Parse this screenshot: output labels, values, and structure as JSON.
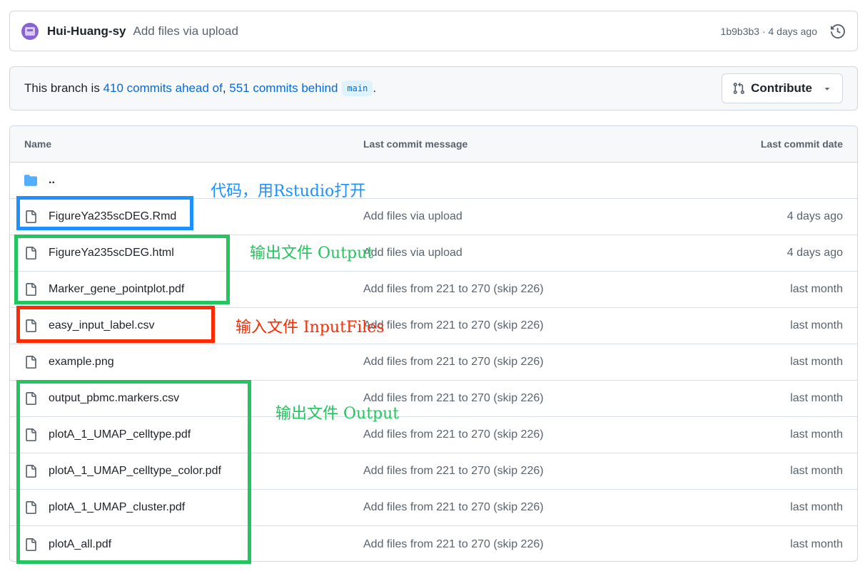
{
  "commit": {
    "author": "Hui-Huang-sy",
    "message": "Add files via upload",
    "meta": "1b9b3b3 · 4 days ago"
  },
  "branch": {
    "prefix": "This branch is ",
    "ahead": "410 commits ahead of",
    "sep": ", ",
    "behind": "551 commits behind",
    "ref": "main",
    "suffix": ".",
    "contribute_label": "Contribute"
  },
  "table": {
    "headers": {
      "name": "Name",
      "message": "Last commit message",
      "date": "Last commit date"
    },
    "parent": "..",
    "rows": [
      {
        "name": "FigureYa235scDEG.Rmd",
        "message": "Add files via upload",
        "date": "4 days ago"
      },
      {
        "name": "FigureYa235scDEG.html",
        "message": "Add files via upload",
        "date": "4 days ago"
      },
      {
        "name": "Marker_gene_pointplot.pdf",
        "message": "Add files from 221 to 270 (skip 226)",
        "date": "last month"
      },
      {
        "name": "easy_input_label.csv",
        "message": "Add files from 221 to 270 (skip 226)",
        "date": "last month"
      },
      {
        "name": "example.png",
        "message": "Add files from 221 to 270 (skip 226)",
        "date": "last month"
      },
      {
        "name": "output_pbmc.markers.csv",
        "message": "Add files from 221 to 270 (skip 226)",
        "date": "last month"
      },
      {
        "name": "plotA_1_UMAP_celltype.pdf",
        "message": "Add files from 221 to 270 (skip 226)",
        "date": "last month"
      },
      {
        "name": "plotA_1_UMAP_celltype_color.pdf",
        "message": "Add files from 221 to 270 (skip 226)",
        "date": "last month"
      },
      {
        "name": "plotA_1_UMAP_cluster.pdf",
        "message": "Add files from 221 to 270 (skip 226)",
        "date": "last month"
      },
      {
        "name": "plotA_all.pdf",
        "message": "Add files from 221 to 270 (skip 226)",
        "date": "last month"
      }
    ]
  },
  "annotations": {
    "code": "代码，用Rstudio打开",
    "output_1": "输出文件 Output",
    "input": "输入文件 InputFiles",
    "output_2": "输出文件 Output"
  },
  "colors": {
    "blue_box": "#1e90ff",
    "green_box": "#22c55e",
    "red_box": "#ff2a00",
    "link": "#0969da",
    "folder": "#54aeff"
  }
}
